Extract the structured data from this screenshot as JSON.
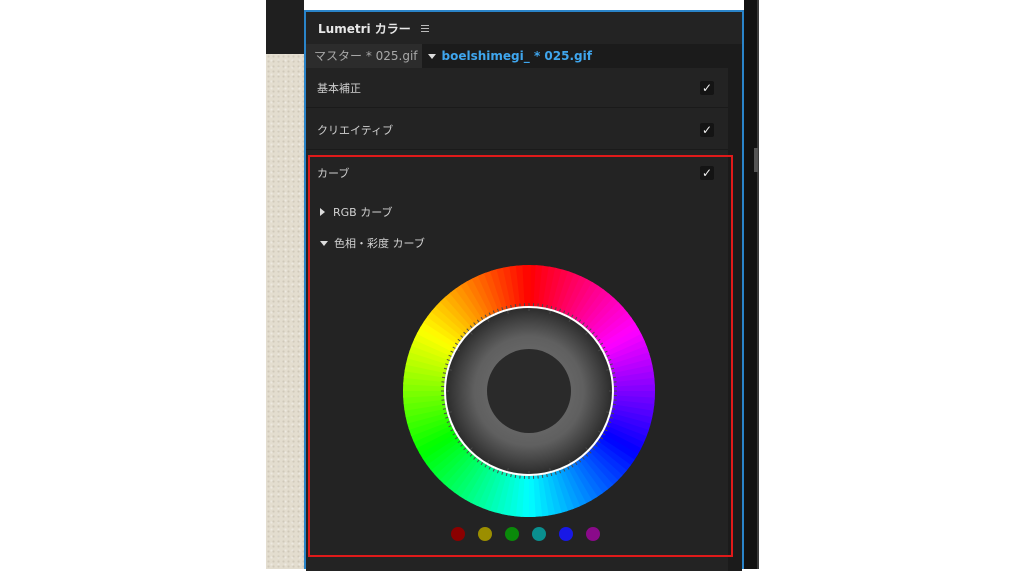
{
  "panel": {
    "title": "Lumetri カラー",
    "menu_icon": "hamburger-icon"
  },
  "clip_selector": {
    "master_clip": "マスター * 025.gif",
    "sequence_clip": "boelshimegi_ * 025.gif",
    "dropdown_icon": "triangle-down-icon"
  },
  "sections": [
    {
      "label": "基本補正",
      "enabled": true
    },
    {
      "label": "クリエイティブ",
      "enabled": true
    },
    {
      "label": "カーブ",
      "enabled": true
    }
  ],
  "checkmark": "✓",
  "curves": {
    "rgb_curve_label": "RGB カーブ",
    "rgb_curve_expanded": false,
    "hue_sat_curve_label": "色相・彩度 カーブ",
    "hue_sat_curve_expanded": true
  },
  "colors": {
    "accent_blue": "#3fa6ee",
    "panel_border": "#2a84c9",
    "highlight_border": "#e01a1a"
  },
  "hue_swatches": [
    "#8b0000",
    "#9b8e00",
    "#0a8a0a",
    "#0a8f8f",
    "#1818e6",
    "#8a0a8a"
  ]
}
